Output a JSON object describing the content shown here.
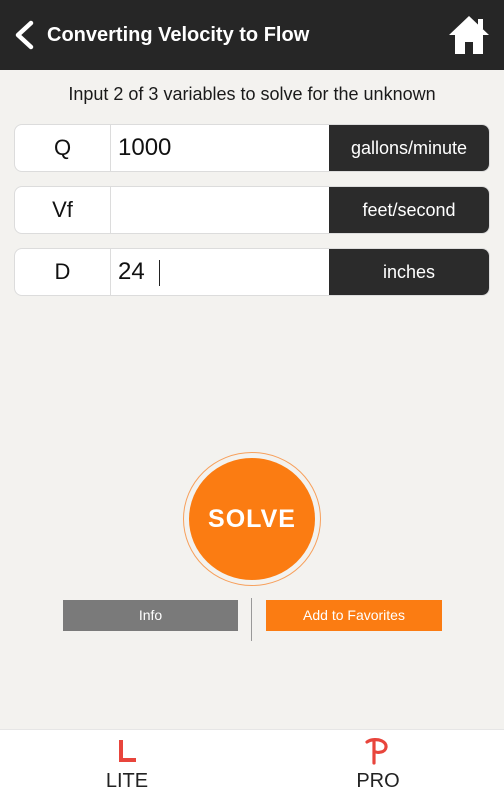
{
  "header": {
    "title": "Converting Velocity to Flow",
    "back_icon": "chevron-left-icon",
    "home_icon": "home-icon"
  },
  "instruction": "Input 2 of 3 variables to solve for the unknown",
  "fields": [
    {
      "label": "Q",
      "value": "1000",
      "placeholder": "",
      "unit": "gallons/minute"
    },
    {
      "label": "Vf",
      "value": "",
      "placeholder": "",
      "unit": "feet/second"
    },
    {
      "label": "D",
      "value": "24",
      "placeholder": "",
      "unit": "inches"
    }
  ],
  "solve_label": "SOLVE",
  "buttons": {
    "info": "Info",
    "favorites": "Add to Favorites"
  },
  "tabs": {
    "lite": "LITE",
    "pro": "PRO"
  },
  "colors": {
    "accent": "#fb7c12",
    "header_bg": "#262626",
    "unit_bg": "#2b2b2b",
    "info_bg": "#7a7a7a",
    "tab_icon": "#e8453c",
    "background": "#f3f2ef"
  }
}
